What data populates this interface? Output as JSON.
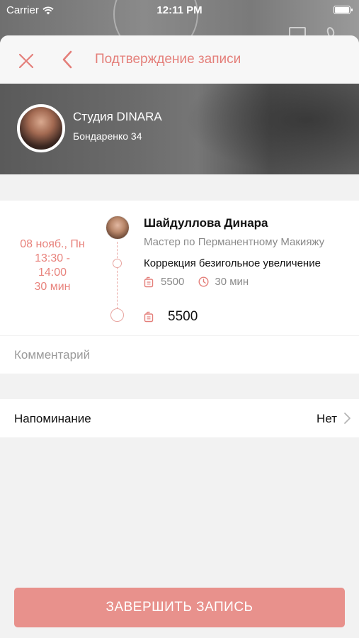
{
  "status_bar": {
    "carrier": "Carrier",
    "time": "12:11 PM"
  },
  "nav": {
    "title": "Подтверждение записи"
  },
  "studio": {
    "name": "Студия DINARA",
    "address": "Бондаренко 34"
  },
  "appointment": {
    "date": "08 нояб., Пн",
    "time_from": "13:30 -",
    "time_to": "14:00",
    "duration": "30 мин",
    "master_name": "Шайдуллова Динара",
    "master_role": "Мастер по Перманентному Макияжу",
    "service_name": "Коррекция безигольное увеличение",
    "service_price": "5500",
    "service_duration": "30 мин",
    "total_price": "5500"
  },
  "comment": {
    "placeholder": "Комментарий",
    "value": ""
  },
  "reminder": {
    "label": "Напоминание",
    "value": "Нет"
  },
  "actions": {
    "complete_label": "ЗАВЕРШИТЬ ЗАПИСЬ"
  },
  "colors": {
    "accent": "#e47f7a",
    "button": "#e8918c",
    "muted": "#8a8a8a"
  }
}
